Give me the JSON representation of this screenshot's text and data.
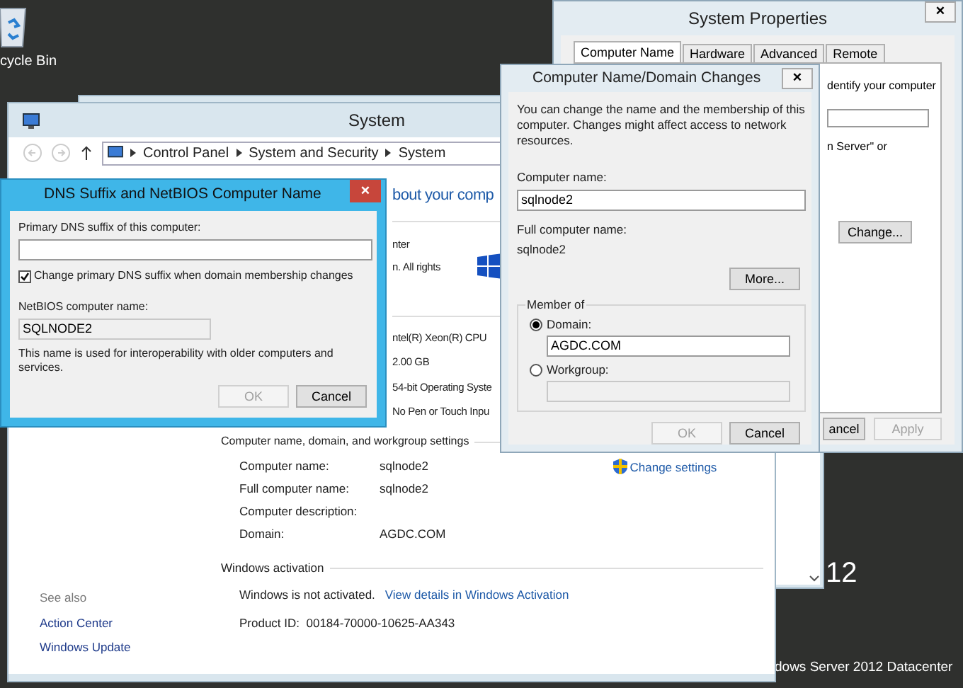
{
  "desktop": {
    "recycle_bin": "cycle Bin",
    "watermark": [
      "12",
      "dows Server 2012 Datacenter"
    ]
  },
  "system_window": {
    "title": "System",
    "breadcrumbs": [
      "Control Panel",
      "System and Security",
      "System"
    ],
    "heading": "bout your comp",
    "edition": [
      "nter",
      "n. All rights"
    ],
    "specs": [
      "ntel(R) Xeon(R) CPU",
      "2.00 GB",
      "54-bit Operating Syste",
      "No Pen or Touch Inpu"
    ],
    "name_section": {
      "title": "Computer name, domain, and workgroup settings",
      "change_link": "Change settings",
      "rows": [
        {
          "label": "Computer name:",
          "value": "sqlnode2"
        },
        {
          "label": "Full computer name:",
          "value": "sqlnode2"
        },
        {
          "label": "Computer description:"
        },
        {
          "label": "Domain:",
          "value": "AGDC.COM"
        }
      ]
    },
    "activation": {
      "title": "Windows activation",
      "status": "Windows is not activated.",
      "link": "View details in Windows Activation",
      "product_id": "Product ID:  00184-70000-10625-AA343"
    },
    "see_also": {
      "title": "See also",
      "links": [
        "Action Center",
        "Windows Update"
      ]
    }
  },
  "system_properties": {
    "title": "System Properties",
    "close": "×",
    "tabs": [
      {
        "label": "Computer Name",
        "selected": true
      },
      {
        "label": "Hardware",
        "selected": false
      },
      {
        "label": "Advanced",
        "selected": false
      },
      {
        "label": "Remote",
        "selected": false
      }
    ],
    "fragments": [
      "dentify your computer",
      "n Server\" or"
    ],
    "change_button": {
      "label": "Change...",
      "disabled": false
    },
    "buttons": [
      {
        "label": "ancel",
        "disabled": false
      },
      {
        "label": "Apply",
        "disabled": true
      }
    ]
  },
  "name_dialog": {
    "title": "Computer Name/Domain Changes",
    "close": "×",
    "intro": "You can change the name and the membership of this computer. Changes might affect access to network resources.",
    "computer_name": {
      "label": "Computer name:",
      "value": "sqlnode2"
    },
    "full_name": {
      "label": "Full computer name:",
      "value": "sqlnode2"
    },
    "more_button": {
      "label": "More...",
      "disabled": false
    },
    "member_of": "Member of",
    "options": [
      {
        "label": "Domain:",
        "selected": true,
        "value": "AGDC.COM"
      },
      {
        "label": "Workgroup:",
        "selected": false
      }
    ],
    "buttons": [
      {
        "label": "OK",
        "disabled": true
      },
      {
        "label": "Cancel",
        "disabled": false
      }
    ]
  },
  "dns_dialog": {
    "title": "DNS Suffix and NetBIOS Computer Name",
    "close": "×",
    "suffix_label": "Primary DNS suffix of this computer:",
    "checkbox": {
      "label": "Change primary DNS suffix when domain membership changes",
      "checked": true
    },
    "netbios_label": "NetBIOS computer name:",
    "netbios_value": "SQLNODE2",
    "note": "This name is used for interoperability with older computers and services.",
    "buttons": [
      {
        "label": "OK",
        "disabled": true
      },
      {
        "label": "Cancel",
        "disabled": false
      }
    ]
  }
}
